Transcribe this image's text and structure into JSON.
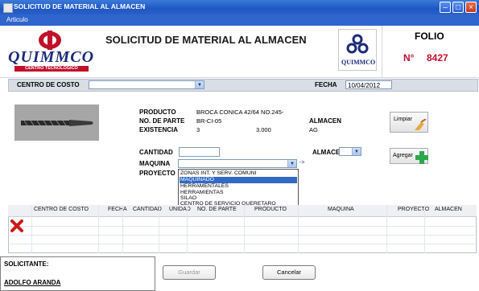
{
  "window": {
    "title": "SOLICITUD DE MATERIAL AL ALMACEN",
    "menu": [
      "Articulo"
    ]
  },
  "header": {
    "logo_left_text": "QUIMMCO",
    "logo_left_sub": "CENTRO TECNOLOGICO",
    "logo_right_text": "QUIMMCO",
    "title": "SOLICITUD DE MATERIAL AL ALMACEN",
    "folio_label": "FOLIO",
    "folio_prefix": "N°",
    "folio_number": "8427"
  },
  "centro": {
    "label": "CENTRO DE COSTO",
    "value": "",
    "fecha_label": "FECHA",
    "fecha_value": "10/04/2012"
  },
  "product": {
    "producto_label": "PRODUCTO",
    "producto_value": "BROCA CONICA 42/64 NO.245-",
    "no_parte_label": "NO. DE PARTE",
    "no_parte_value": "BR-CI-05",
    "existencia_label": "EXISTENCIA",
    "existencia_value": "3",
    "existencia_value2": "3.000",
    "almacen_label": "ALMACEN",
    "almacen_value": "AG"
  },
  "form": {
    "cantidad_label": "CANTIDAD",
    "cantidad_value": "",
    "almacen_label": "ALMACEN",
    "almacen_value": "",
    "maquina_label": "MAQUINA",
    "maquina_value": "",
    "proyecto_label": "PROYECTO",
    "arrow_glyph": "->",
    "maquina_options": [
      "ZONAS INT. Y SERV. COMUNI",
      "MAQUINADO",
      "HERRAMENTALES",
      "HERRAMIENTAS",
      "SILAO",
      "CENTRO DE SERVICIO QUERETARO"
    ],
    "selected_option": "MAQUINADO"
  },
  "buttons": {
    "limpiar": "Limpiar",
    "agregar": "Agregar",
    "guardar": "Guardar",
    "cancelar": "Cancelar"
  },
  "grid": {
    "columns": [
      "CENTRO DE COSTO",
      "FECHA",
      "CANTIDAD",
      "UNIDAD",
      "NO. DE PARTE",
      "PRODUCTO",
      "MAQUINA",
      "PROYECTO",
      "ALMACEN"
    ],
    "rows": []
  },
  "solicitante": {
    "label": "SOLICITANTE:",
    "name": "ADOLFO ARANDA"
  },
  "colors": {
    "titlebar": "#1f57c2",
    "folio_number": "#c0102a",
    "logo": "#1b2a7a",
    "selection": "#316ac5",
    "delete_icon": "#d01818"
  }
}
